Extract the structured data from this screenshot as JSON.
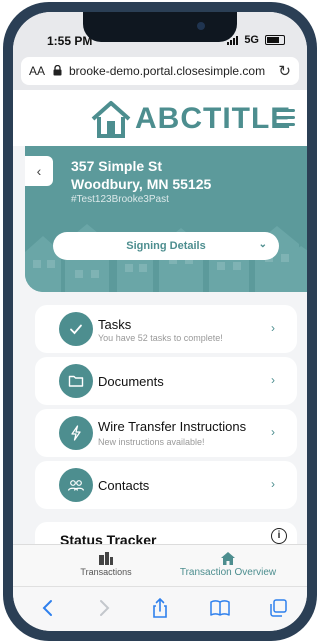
{
  "status_bar": {
    "time": "1:55 PM",
    "network": "5G"
  },
  "browser": {
    "text_size_label": "AA",
    "url": "brooke-demo.portal.closesimple.com"
  },
  "brand": {
    "logo_text": "ABCTITLE",
    "accent_color": "#4d8e8f"
  },
  "property": {
    "address_line1": "357 Simple St",
    "address_line2": "Woodbury, MN 55125",
    "reference": "#Test123Brooke3Past"
  },
  "signing_details": {
    "label": "Signing Details"
  },
  "cards": [
    {
      "title": "Tasks",
      "subtitle": "You have 52 tasks to complete!",
      "icon": "check-icon"
    },
    {
      "title": "Documents",
      "subtitle": "",
      "icon": "folder-icon"
    },
    {
      "title": "Wire Transfer Instructions",
      "subtitle": "New instructions available!",
      "icon": "bolt-icon"
    },
    {
      "title": "Contacts",
      "subtitle": "",
      "icon": "people-icon"
    }
  ],
  "status_tracker": {
    "title": "Status Tracker"
  },
  "tabs": [
    {
      "label": "Transactions",
      "icon": "buildings-icon",
      "active": false
    },
    {
      "label": "Transaction Overview",
      "icon": "home-icon",
      "active": true
    }
  ]
}
